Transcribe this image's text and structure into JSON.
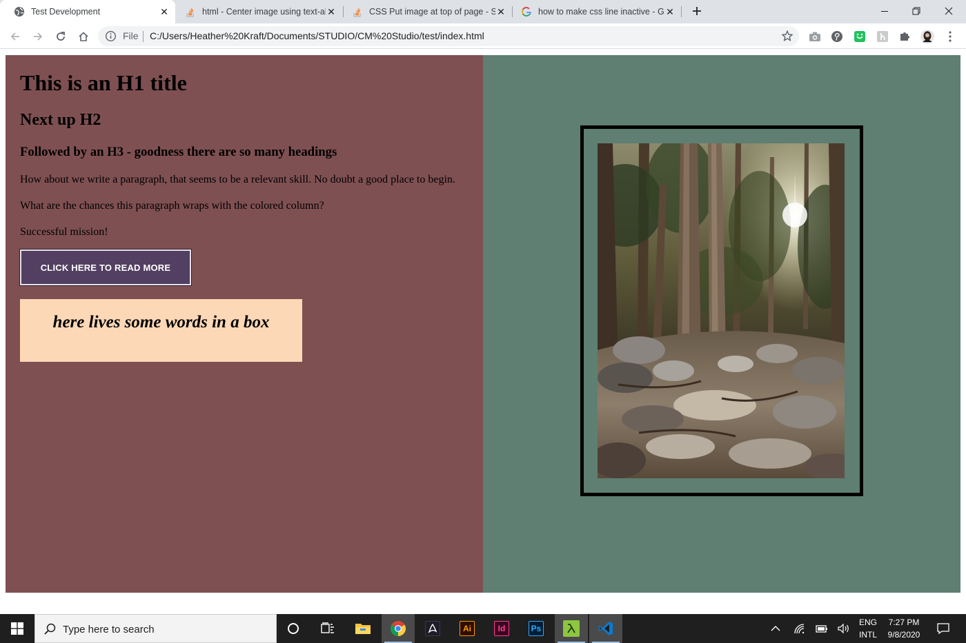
{
  "browser": {
    "tabs": [
      {
        "title": "Test Development",
        "active": true,
        "favicon": "globe-icon"
      },
      {
        "title": "html - Center image using text-al",
        "active": false,
        "favicon": "stackoverflow-icon"
      },
      {
        "title": "CSS Put image at top of page - St",
        "active": false,
        "favicon": "stackoverflow-icon"
      },
      {
        "title": "how to make css line inactive - Go",
        "active": false,
        "favicon": "google-icon"
      }
    ],
    "address": {
      "scheme_label": "File",
      "url": "C:/Users/Heather%20Kraft/Documents/STUDIO/CM%20Studio/test/index.html"
    },
    "extensions": [
      "camera-icon",
      "pinterest-icon",
      "extension-green-icon",
      "extension-gray-icon",
      "puzzle-icon",
      "profile-avatar"
    ]
  },
  "page": {
    "h1": "This is an H1 title",
    "h2": "Next up H2",
    "h3": "Followed by an H3 - goodness there are so many headings",
    "paragraphs": [
      "How about we write a paragraph, that seems to be a relevant skill. No doubt a good place to begin.",
      "What are the chances this paragraph wraps with the colored column?",
      "Successful mission!"
    ],
    "button_label": "CLICK HERE TO READ MORE",
    "box_text": "here lives some words in a box",
    "image_description": "forest trail photo",
    "colors": {
      "left_column": "#7f5052",
      "right_column": "#5e7f71",
      "button": "#523f62",
      "box": "#fdd8b6"
    }
  },
  "taskbar": {
    "search_placeholder": "Type here to search",
    "apps": [
      "cortana-icon",
      "task-view-icon",
      "file-explorer-icon",
      "chrome-icon",
      "acrobat-icon",
      "illustrator-icon",
      "indesign-icon",
      "photoshop-icon",
      "lambda-app-icon",
      "vscode-icon"
    ],
    "ai_label": "Ai",
    "id_label": "Id",
    "ps_label": "Ps",
    "lang_top": "ENG",
    "lang_bottom": "INTL",
    "time": "7:27 PM",
    "date": "9/8/2020"
  }
}
